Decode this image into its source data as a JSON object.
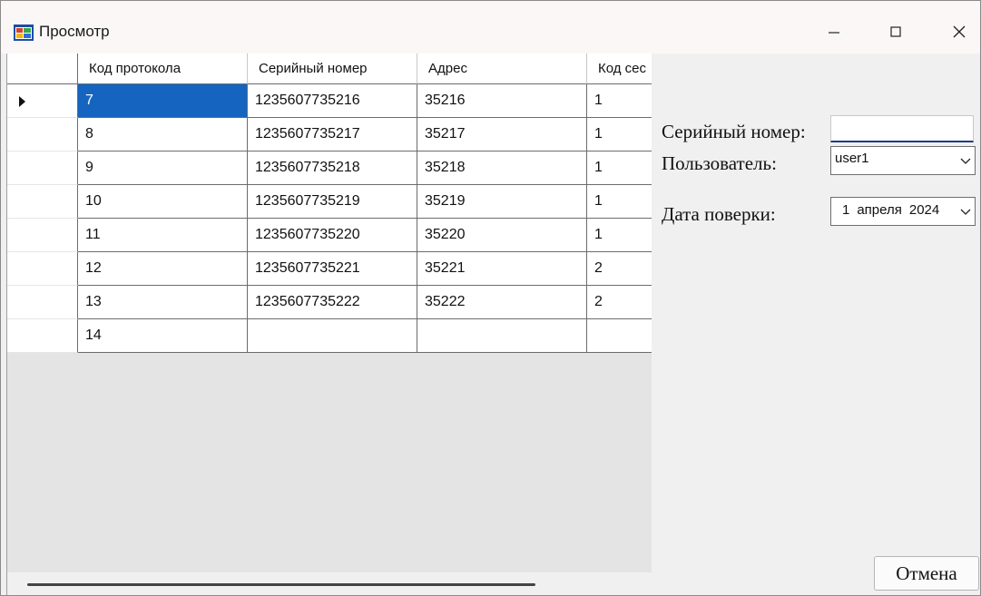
{
  "window": {
    "title": "Просмотр"
  },
  "grid": {
    "columns": [
      "Код протокола",
      "Серийный номер",
      "Адрес",
      "Код сес"
    ],
    "rows": [
      [
        "7",
        "1235607735216",
        "35216",
        "1"
      ],
      [
        "8",
        "1235607735217",
        "35217",
        "1"
      ],
      [
        "9",
        "1235607735218",
        "35218",
        "1"
      ],
      [
        "10",
        "1235607735219",
        "35219",
        "1"
      ],
      [
        "11",
        "1235607735220",
        "35220",
        "1"
      ],
      [
        "12",
        "1235607735221",
        "35221",
        "2"
      ],
      [
        "13",
        "1235607735222",
        "35222",
        "2"
      ],
      [
        "14",
        "",
        "",
        ""
      ]
    ],
    "current_row_index": 0,
    "selection_color": "#1565c0"
  },
  "form": {
    "serial_label": "Серийный номер:",
    "serial_value": "",
    "user_label": "Пользователь:",
    "user_value": "user1",
    "date_label": "Дата поверки:",
    "date_day": "1",
    "date_month": "апреля",
    "date_year": "2024"
  },
  "buttons": {
    "cancel_label": "Отмена"
  },
  "icons": {
    "app": "form-window-icon",
    "minimize": "minimize-icon",
    "maximize": "maximize-icon",
    "close": "close-icon",
    "dropdown": "chevron-down-icon",
    "row_indicator": "current-row-arrow-icon"
  }
}
